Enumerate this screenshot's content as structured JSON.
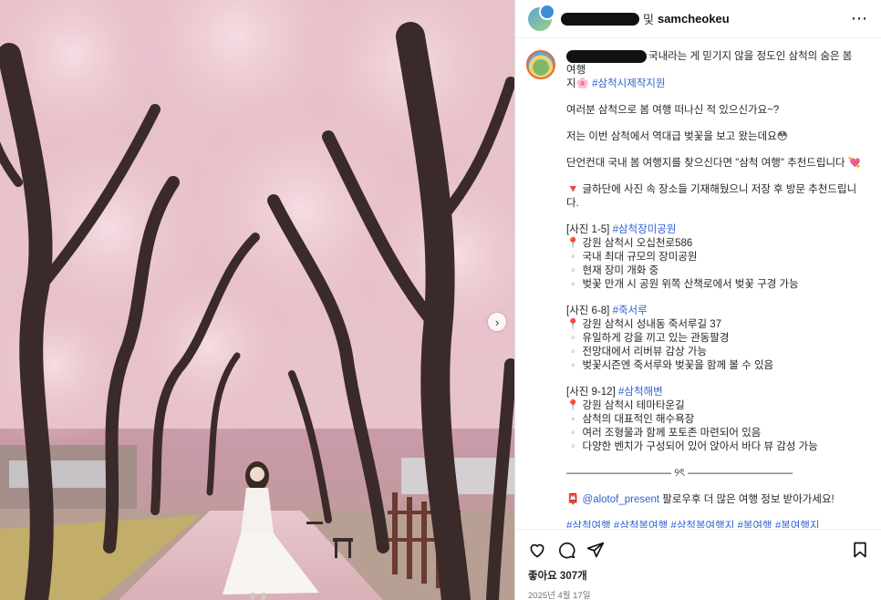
{
  "header": {
    "account": "samcheokeu",
    "separator": "및",
    "more_icon": "more-horizontal-icon"
  },
  "caption": {
    "lines": [
      {
        "text": "국내라는 게 믿기지 않을 정도인 삼척의 숨은 봄 여행",
        "tags": []
      },
      {
        "text": "지🌸 ",
        "tags": [
          "#삼척시제작지원"
        ]
      },
      {
        "text": "",
        "tags": []
      },
      {
        "text": "여러분 삼척으로 봄 여행 떠나신 적 있으신가요~?",
        "tags": []
      },
      {
        "text": "",
        "tags": []
      },
      {
        "text": "저는 이번 삼척에서 역대급 벚꽃을 보고 왔는데요😳",
        "tags": []
      },
      {
        "text": "",
        "tags": []
      },
      {
        "text": "단언컨대 국내 봄 여행지를 찾으신다면 \"삼척 여행\" 추천드립니다 💘",
        "tags": []
      },
      {
        "text": "",
        "tags": []
      },
      {
        "text": "🔻 글하단에 사진 속 장소들 기재해뒀으니 저장 후 방문 추천드립니",
        "tags": []
      },
      {
        "text": "다.",
        "tags": []
      },
      {
        "text": "",
        "tags": []
      },
      {
        "text": "[사진 1-5] ",
        "tags": [
          "#삼척장미공원"
        ]
      },
      {
        "text": "📍 강원 삼척시 오십천로586",
        "tags": []
      },
      {
        "text": "▫️ 국내 최대 규모의 장미공원",
        "tags": []
      },
      {
        "text": "▫️ 현재 장미 개화 중",
        "tags": []
      },
      {
        "text": "▫️ 벚꽃 만개 시 공원 위쪽 산책로에서 벚꽃 구경 가능",
        "tags": []
      },
      {
        "text": "",
        "tags": []
      },
      {
        "text": "[사진 6-8] ",
        "tags": [
          "#죽서루"
        ]
      },
      {
        "text": "📍 강원 삼척시 성내동 죽서루길 37",
        "tags": []
      },
      {
        "text": "▫️ 유일하게 강을 끼고 있는 관동팔경",
        "tags": []
      },
      {
        "text": "▫️ 전망대에서 리버뷰 감상 가능",
        "tags": []
      },
      {
        "text": "▫️ 벚꽃시즌엔 죽서루와 벚꽃을 함께 볼 수 있음",
        "tags": []
      },
      {
        "text": "",
        "tags": []
      },
      {
        "text": "[사진 9-12] ",
        "tags": [
          "#삼척해변"
        ]
      },
      {
        "text": "📍 강원 삼척시 테마타운길",
        "tags": []
      },
      {
        "text": "▫️ 삼척의 대표적인 해수욕장",
        "tags": []
      },
      {
        "text": "▫️ 여러 조형물과 함께 포토존 마련되어 있음",
        "tags": []
      },
      {
        "text": "▫️ 다양한 벤치가 구성되어 있어 앉아서 바다 뷰 감성 가능",
        "tags": []
      },
      {
        "text": "",
        "tags": []
      },
      {
        "text": "—————————— ୨ৎ ——————————",
        "tags": []
      },
      {
        "text": "",
        "tags": []
      },
      {
        "text": "📮 ",
        "tags": [
          "@alotof_present"
        ],
        "suffix": " 팔로우후 더 많은 여행 정보 받아가세요!"
      },
      {
        "text": "",
        "tags": []
      },
      {
        "text": "",
        "tags": [
          "#삼척여행",
          "#삼척봄여행",
          "#삼척봄여행지",
          "#봄여행",
          "#봄여행지"
        ]
      }
    ]
  },
  "actions": {
    "like_icon": "heart-icon",
    "comment_icon": "comment-icon",
    "share_icon": "share-icon",
    "save_icon": "bookmark-icon",
    "likes": "좋아요 307개",
    "date": "2025년 4월 17일"
  },
  "photo": {
    "next_icon": "chevron-right-icon"
  },
  "colors": {
    "hashtag": "#2f5fd0",
    "blossom": "#e8c2cc"
  }
}
